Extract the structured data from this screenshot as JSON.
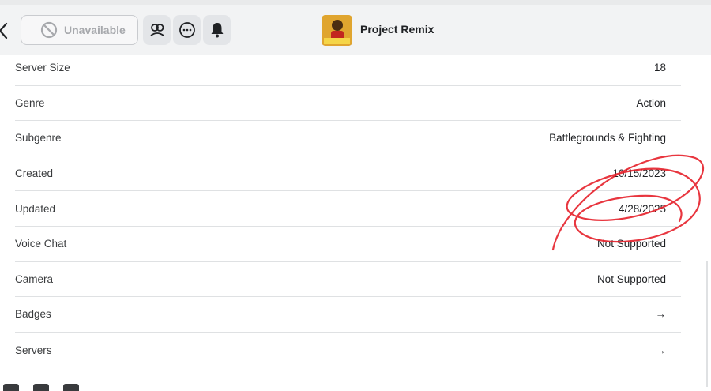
{
  "header": {
    "unavailable_label": "Unavailable",
    "game_title": "Project Remix"
  },
  "details": [
    {
      "label": "Server Size",
      "value": "18"
    },
    {
      "label": "Genre",
      "value": "Action"
    },
    {
      "label": "Subgenre",
      "value": "Battlegrounds & Fighting"
    },
    {
      "label": "Created",
      "value": "10/15/2023"
    },
    {
      "label": "Updated",
      "value": "4/28/2025"
    },
    {
      "label": "Voice Chat",
      "value": "Not Supported"
    },
    {
      "label": "Camera",
      "value": "Not Supported"
    },
    {
      "label": "Badges",
      "value": "→"
    },
    {
      "label": "Servers",
      "value": "→"
    }
  ],
  "icons": {
    "back": "chevron-left-icon",
    "unavailable": "prohibit-icon",
    "friends": "friends-icon",
    "more": "more-options-icon",
    "notify": "bell-icon"
  },
  "colors": {
    "annotation": "#e5202a",
    "header_bg": "#f2f3f4"
  }
}
